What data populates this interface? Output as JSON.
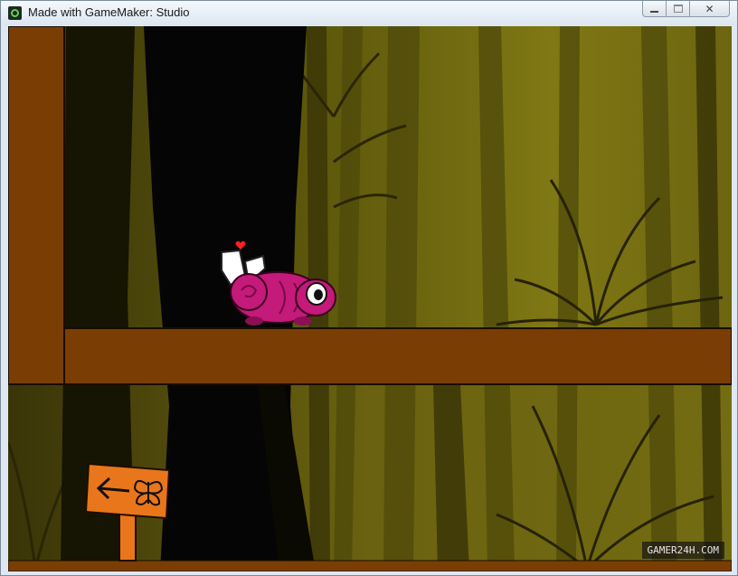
{
  "window": {
    "title": "Made with GameMaker: Studio",
    "controls": {
      "minimize_icon": "minimize-icon",
      "maximize_icon": "maximize-icon",
      "close_icon": "close-icon"
    }
  },
  "game": {
    "watermark": "GAMER24H.COM",
    "sign_icons": [
      "arrow-left-icon",
      "butterfly-icon"
    ],
    "player_icon": "heart-icon",
    "colors": {
      "platform": "#7a3e05",
      "forest_light": "#7d7410",
      "forest_dark": "#2f2a06",
      "trunk": "#050505",
      "creature": "#c41a7a",
      "sign": "#e9761b"
    }
  }
}
